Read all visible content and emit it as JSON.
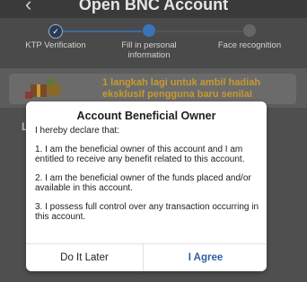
{
  "header": {
    "title": "Open BNC Account",
    "back_icon": "back-arrow-icon"
  },
  "stepper": {
    "steps": [
      {
        "label": "KTP Verification",
        "state": "done",
        "icon": "check-icon"
      },
      {
        "label": "Fill in personal information",
        "state": "active"
      },
      {
        "label": "Face recognition",
        "state": "inactive"
      }
    ]
  },
  "banner": {
    "text": "1 langkah lagi untuk ambil hadiah eksklusif pengguna baru senilai",
    "icon": "gift-icon",
    "accent": "#c89a2e"
  },
  "background": {
    "letter": "L"
  },
  "modal": {
    "title": "Account Beneficial Owner",
    "intro": "I hereby declare that:",
    "items": [
      "1. I am the beneficial owner of this account and I am entitled to receive any benefit related to this account.",
      "2. I am the beneficial owner of the funds placed and/or available in this account.",
      "3. I possess full control over any transaction occurring in this account."
    ],
    "later_label": "Do It Later",
    "agree_label": "I Agree"
  },
  "colors": {
    "primary": "#2f5fa8",
    "overlay": "#5c5c5c"
  }
}
